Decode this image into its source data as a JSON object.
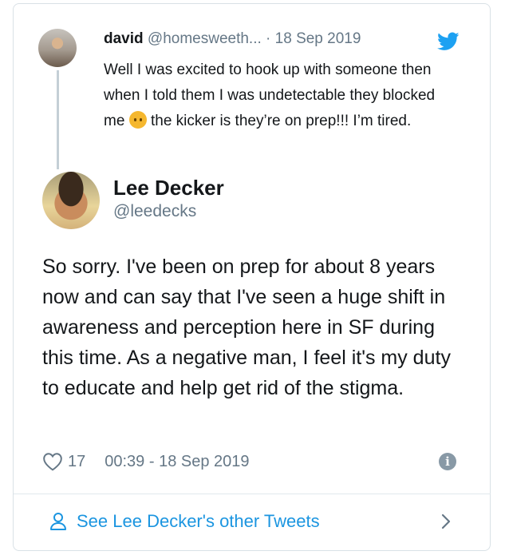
{
  "parent_tweet": {
    "name": "david",
    "handle": "@homesweeth...",
    "separator": "·",
    "date": "18 Sep 2019",
    "text_before_emoji": "Well I was excited to hook up with someone then when I told them I was undetectable they blocked me",
    "emoji": "upside-down-face",
    "text_after_emoji": "the kicker is they’re on prep!!! I’m tired."
  },
  "tweet": {
    "author_name": "Lee Decker",
    "author_handle": "@leedecks",
    "text": "So sorry. I've been on prep for about 8 years now and can say that I've seen a huge shift in awareness and perception here in SF during this time. As a negative man, I feel it's my duty to educate and help get rid of the stigma.",
    "like_count": "17",
    "timestamp": "00:39 - 18 Sep 2019"
  },
  "footer": {
    "link_text": "See Lee Decker's other Tweets"
  },
  "icons": {
    "brand": "twitter-bird-icon",
    "like": "heart-icon",
    "info": "info-icon",
    "profile": "person-icon",
    "next": "chevron-right-icon"
  },
  "colors": {
    "link": "#1b95e0",
    "secondary_text": "#657786",
    "border": "#d9e1e6"
  }
}
